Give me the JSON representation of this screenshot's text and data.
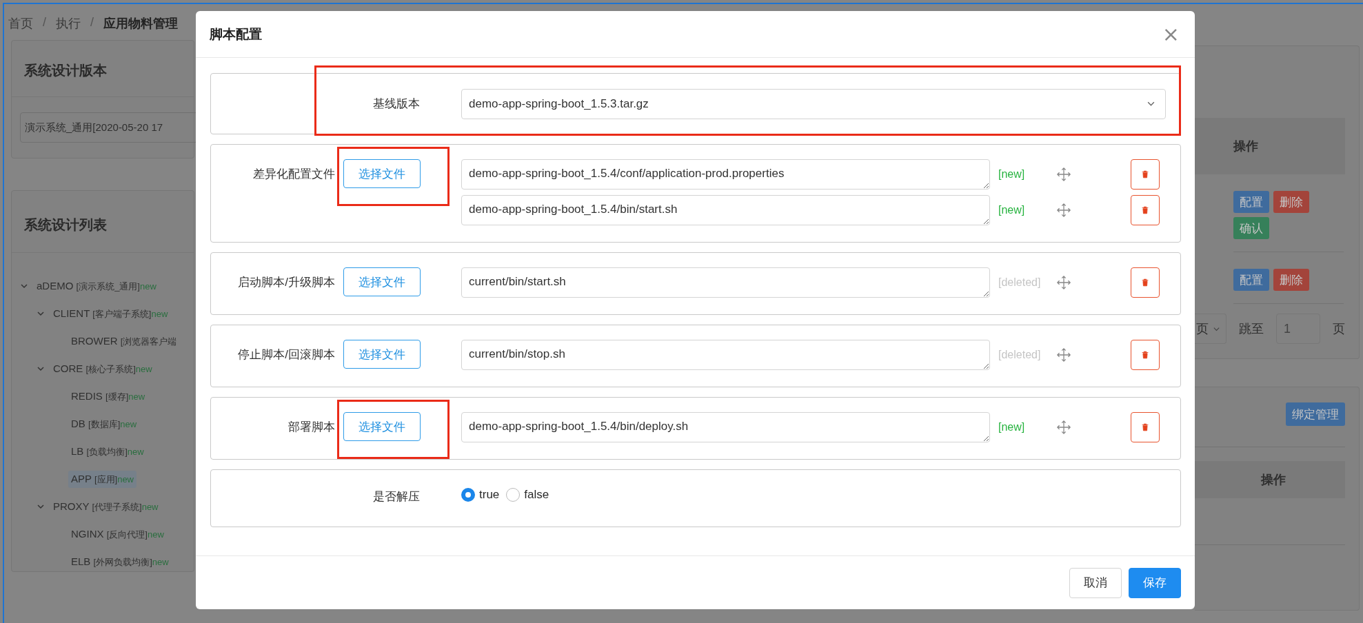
{
  "breadcrumb": [
    {
      "label": "首页",
      "current": false
    },
    {
      "label": "执行",
      "current": false
    },
    {
      "label": "应用物料管理",
      "current": true
    }
  ],
  "breadcrumb_separator": "/",
  "left": {
    "version_card": {
      "title": "系统设计版本",
      "select_value": "演示系统_通用[2020-05-20 17"
    },
    "list_card": {
      "title": "系统设计列表",
      "tree": [
        {
          "name": "aDEMO",
          "desc": "[演示系统_通用]",
          "tag": "new",
          "expanded": true,
          "selected": false,
          "children": [
            {
              "name": "CLIENT",
              "desc": "[客户端子系统]",
              "tag": "new",
              "expanded": true,
              "selected": false,
              "children": [
                {
                  "name": "BROWER",
                  "desc": "[浏览器客户端",
                  "selected": false
                }
              ]
            },
            {
              "name": "CORE",
              "desc": "[核心子系统]",
              "tag": "new",
              "expanded": true,
              "selected": false,
              "children": [
                {
                  "name": "REDIS",
                  "desc": "[缓存]",
                  "tag": "new",
                  "selected": false
                },
                {
                  "name": "DB",
                  "desc": "[数据库]",
                  "tag": "new",
                  "selected": false
                },
                {
                  "name": "LB",
                  "desc": "[负载均衡]",
                  "tag": "new",
                  "selected": false
                },
                {
                  "name": "APP",
                  "desc": "[应用]",
                  "tag": "new",
                  "selected": true
                }
              ]
            },
            {
              "name": "PROXY",
              "desc": "[代理子系统]",
              "tag": "new",
              "expanded": true,
              "selected": false,
              "children": [
                {
                  "name": "NGINX",
                  "desc": "[反向代理]",
                  "tag": "new",
                  "selected": false
                },
                {
                  "name": "ELB",
                  "desc": "[外网负载均衡]",
                  "tag": "new",
                  "selected": false
                }
              ]
            }
          ]
        }
      ]
    }
  },
  "right": {
    "table_header": "操作",
    "rows": [
      {
        "actions": [
          {
            "label": "配置",
            "kind": "primary"
          },
          {
            "label": "删除",
            "kind": "danger"
          },
          {
            "label": "确认",
            "kind": "success"
          }
        ]
      },
      {
        "actions": [
          {
            "label": "配置",
            "kind": "primary"
          },
          {
            "label": "删除",
            "kind": "danger"
          }
        ]
      }
    ],
    "pagination": {
      "page_size_partial": "页",
      "jump_label": "跳至",
      "jump_value": "1",
      "page_label": "页"
    },
    "bind_button": "绑定管理",
    "table2_header": "操作"
  },
  "dialog": {
    "title": "脚本配置",
    "close": "×",
    "sections": [
      {
        "kind": "select",
        "label": "基线版本",
        "value": "demo-app-spring-boot_1.5.3.tar.gz",
        "highlighted": true
      },
      {
        "kind": "files",
        "label": "差异化配置文件",
        "button": "选择文件",
        "highlighted": true,
        "files": [
          {
            "path": "demo-app-spring-boot_1.5.4/conf/application-prod.properties",
            "tag": "[new]",
            "color": "#27b33f"
          },
          {
            "path": "demo-app-spring-boot_1.5.4/bin/start.sh",
            "tag": "[new]",
            "color": "#27b33f"
          }
        ]
      },
      {
        "kind": "files",
        "label": "启动脚本/升级脚本",
        "button": "选择文件",
        "highlighted": false,
        "files": [
          {
            "path": "current/bin/start.sh",
            "tag": "[deleted]",
            "color": "#c5c5c5"
          }
        ]
      },
      {
        "kind": "files",
        "label": "停止脚本/回滚脚本",
        "button": "选择文件",
        "highlighted": false,
        "files": [
          {
            "path": "current/bin/stop.sh",
            "tag": "[deleted]",
            "color": "#c5c5c5"
          }
        ]
      },
      {
        "kind": "files",
        "label": "部署脚本",
        "button": "选择文件",
        "highlighted": true,
        "files": [
          {
            "path": "demo-app-spring-boot_1.5.4/bin/deploy.sh",
            "tag": "[new]",
            "color": "#27b33f"
          }
        ]
      },
      {
        "kind": "radio",
        "label": "是否解压",
        "options": [
          {
            "label": "true",
            "selected": true
          },
          {
            "label": "false",
            "selected": false
          }
        ]
      }
    ],
    "buttons": [
      {
        "label": "取消",
        "kind": "default"
      },
      {
        "label": "保存",
        "kind": "primary"
      }
    ]
  }
}
